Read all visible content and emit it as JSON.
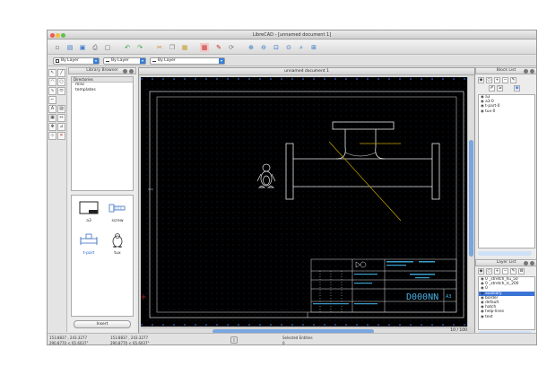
{
  "window": {
    "title": "LibreCAD - [unnamed document 1]"
  },
  "toolbar": {
    "icons": [
      "new-icon",
      "open-icon",
      "save-icon",
      "print-icon",
      "print-preview-icon",
      "undo-icon",
      "redo-icon",
      "cut-icon",
      "copy-icon",
      "paste-icon",
      "grid-icon",
      "draft-icon",
      "redraw-icon",
      "zoom-in-icon",
      "zoom-out-icon",
      "zoom-auto-icon",
      "zoom-previous-icon",
      "zoom-window-icon",
      "zoom-pan-icon"
    ]
  },
  "props": {
    "color": "By Layer",
    "width": "By Layer",
    "linetype": "By Layer"
  },
  "library": {
    "title": "Library Browser",
    "dir_header": "Directories",
    "dirs": [
      "misc",
      "templates"
    ],
    "thumbs": [
      {
        "label": "a3"
      },
      {
        "label": "screw"
      },
      {
        "label": "t-part"
      },
      {
        "label": "tux"
      }
    ],
    "insert": "Insert"
  },
  "document": {
    "title": "unnamed document 1",
    "page": "10 / 100"
  },
  "blocks": {
    "title": "Block List",
    "items": [
      "a3",
      "a3-0",
      "t-part-0",
      "tux-0"
    ]
  },
  "layers": {
    "title": "Layer List",
    "items": [
      {
        "name": "0 _stretch_hu_50",
        "selected": false
      },
      {
        "name": "0 _stretch_lc_200",
        "selected": false
      },
      {
        "name": "0",
        "selected": false
      },
      {
        "name": "auxiliary",
        "selected": true
      },
      {
        "name": "border",
        "selected": false
      },
      {
        "name": "default",
        "selected": false
      },
      {
        "name": "hatch",
        "selected": false
      },
      {
        "name": "help-lines",
        "selected": false
      },
      {
        "name": "text",
        "selected": false
      }
    ]
  },
  "titleblock": {
    "number": "D000NN",
    "code": "A3"
  },
  "status": {
    "abs_coord": "153.8837 , 243.3277",
    "abs_polar": "290.8770 < 65.6037°",
    "rel_coord": "153.8837 , 243.3277",
    "rel_polar": "290.8770 < 65.6037°",
    "selected_label": "Selected Entities",
    "selected_count": "0"
  },
  "colors": {
    "canvas": "#000000",
    "grid": "#1f3a7a",
    "drawing": "#e8e8e8",
    "accent": "#3c74d6",
    "aux_line": "#c8a200"
  }
}
